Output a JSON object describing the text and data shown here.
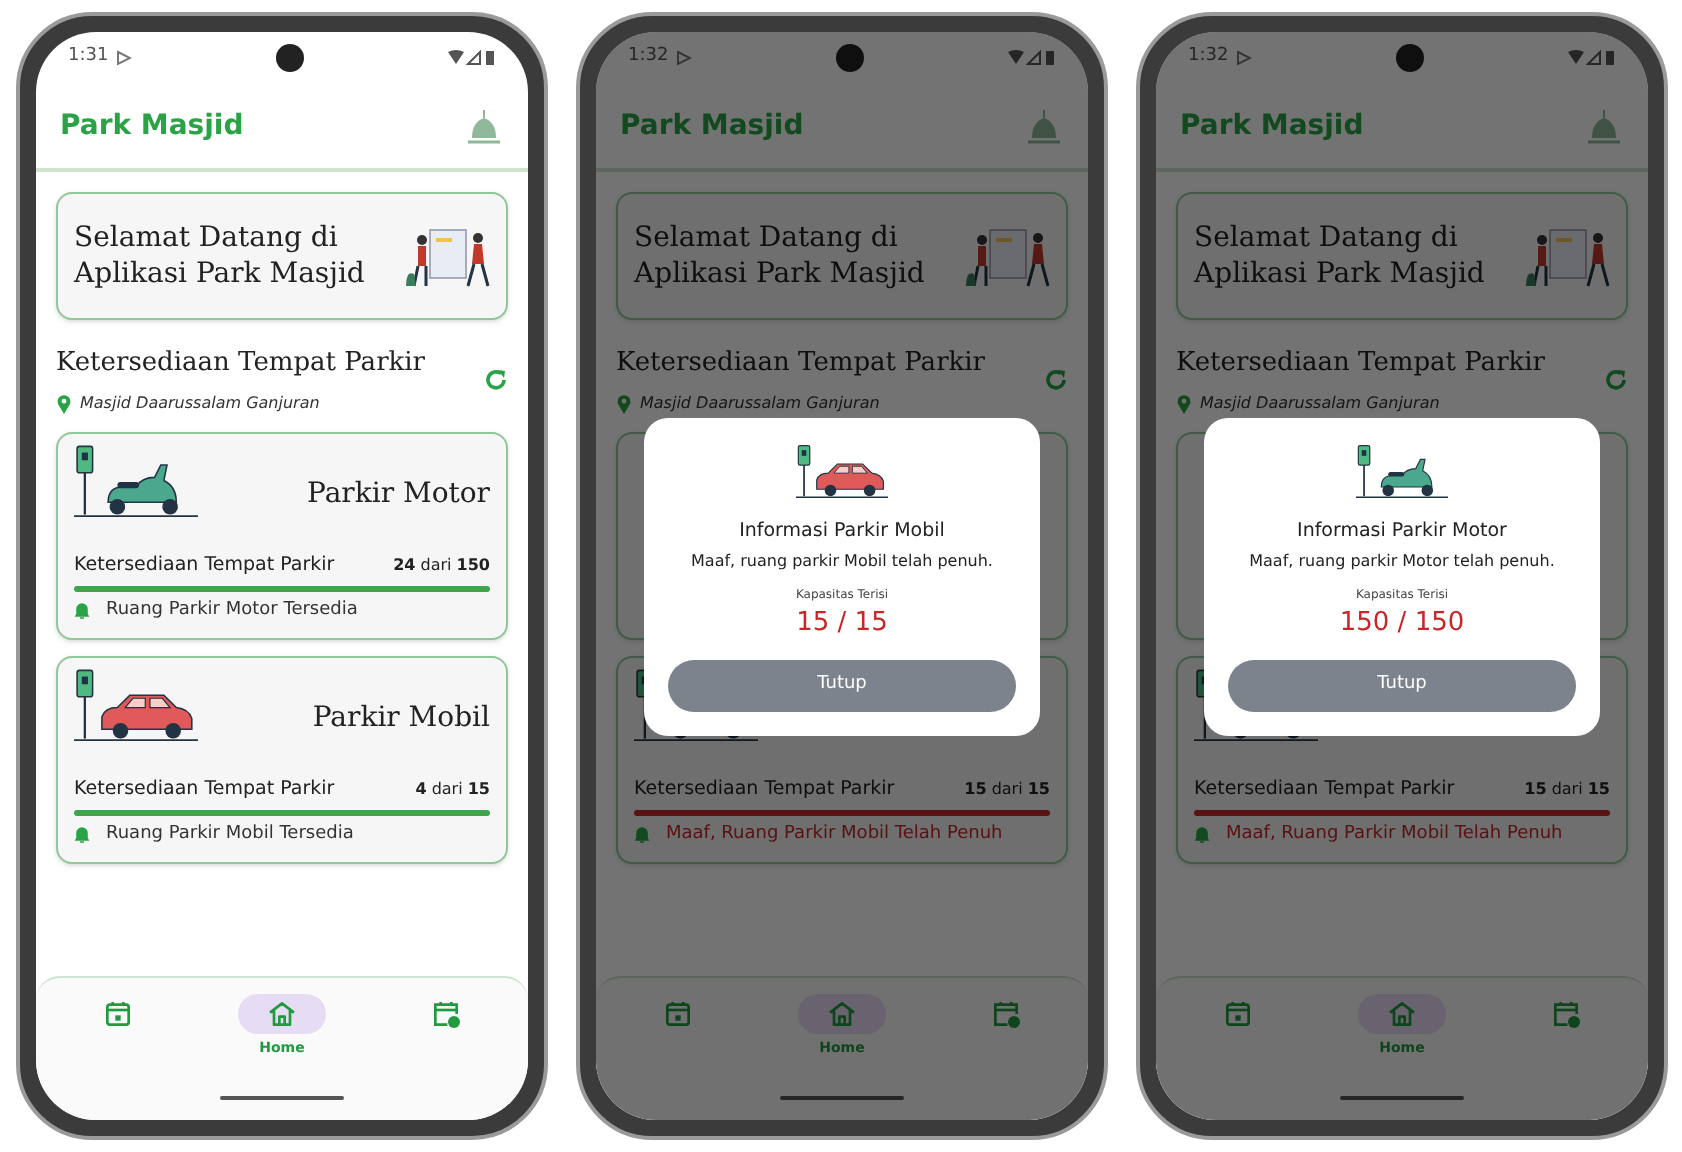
{
  "phones": [
    {
      "status_bar": {
        "time": "1:31"
      },
      "app_title": "Park Masjid",
      "welcome": "Selamat Datang di Aplikasi Park Masjid",
      "section_title": "Ketersediaan Tempat Parkir",
      "location": "Masjid Daarussalam Ganjuran",
      "cards": [
        {
          "kind": "motor",
          "title": "Parkir Motor",
          "label": "Ketersediaan Tempat Parkir",
          "count": "**24** dari **150**",
          "status": "Ruang Parkir Motor Tersedia",
          "full": false
        },
        {
          "kind": "car",
          "title": "Parkir Mobil",
          "label": "Ketersediaan Tempat Parkir",
          "count": "**4** dari **15**",
          "status": "Ruang Parkir Mobil Tersedia",
          "full": false
        }
      ],
      "nav": [
        {
          "kind": "calendar",
          "selected": false
        },
        {
          "kind": "home",
          "label": "Home",
          "selected": true
        },
        {
          "kind": "calendar-clock",
          "selected": false
        }
      ]
    },
    {
      "status_bar": {
        "time": "1:32"
      },
      "app_title": "Park Masjid",
      "welcome": "Selamat Datang di Aplikasi Park Masjid",
      "section_title": "Ketersediaan Tempat Parkir",
      "location": "Masjid Daarussalam Ganjuran",
      "cards": [
        {
          "kind": "hidden"
        },
        {
          "kind": "car",
          "label": "Ketersediaan Tempat Parkir",
          "count": "**15** dari **15**",
          "status": "Maaf, Ruang Parkir Mobil Telah Penuh",
          "full": true
        }
      ],
      "nav": [
        {
          "kind": "calendar",
          "selected": false
        },
        {
          "kind": "home",
          "label": "Home",
          "selected": true
        },
        {
          "kind": "calendar-clock",
          "selected": false
        }
      ],
      "dialog": {
        "kind": "car",
        "title": "Informasi Parkir Mobil",
        "message": "Maaf, ruang parkir Mobil telah penuh.",
        "capacity_label": "Kapasitas Terisi",
        "capacity": "15 / 15",
        "button": "Tutup"
      }
    },
    {
      "status_bar": {
        "time": "1:32"
      },
      "app_title": "Park Masjid",
      "welcome": "Selamat Datang di Aplikasi Park Masjid",
      "section_title": "Ketersediaan Tempat Parkir",
      "location": "Masjid Daarussalam Ganjuran",
      "cards": [
        {
          "kind": "hidden"
        },
        {
          "kind": "car",
          "label": "Ketersediaan Tempat Parkir",
          "count": "**15** dari **15**",
          "status": "Maaf, Ruang Parkir Mobil Telah Penuh",
          "full": true
        }
      ],
      "nav": [
        {
          "kind": "calendar",
          "selected": false
        },
        {
          "kind": "home",
          "label": "Home",
          "selected": true
        },
        {
          "kind": "calendar-clock",
          "selected": false
        }
      ],
      "dialog": {
        "kind": "motor",
        "title": "Informasi Parkir Motor",
        "message": "Maaf, ruang parkir Motor telah penuh.",
        "capacity_label": "Kapasitas Terisi",
        "capacity": "150 / 150",
        "button": "Tutup"
      }
    }
  ]
}
